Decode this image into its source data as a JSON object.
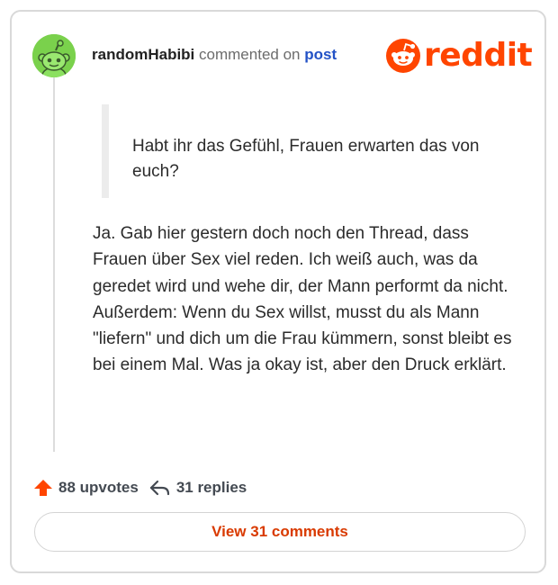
{
  "comment": {
    "username": "randomHabibi",
    "action_text": "commented on",
    "post_link_label": "post",
    "quote": "Habt ihr das Gefühl, Frauen erwarten das von euch?",
    "body": "Ja. Gab hier gestern doch noch den Thread, dass Frauen über Sex viel reden. Ich weiß auch, was da geredet wird und wehe dir, der Mann performt da nicht. Außerdem: Wenn du Sex willst, musst du als Mann \"liefern\" und dich um die Frau kümmern, sonst bleibt es bei einem Mal. Was ja okay ist, aber den Druck erklärt."
  },
  "logo": {
    "text": "reddit",
    "icon": "reddit-alien-icon"
  },
  "stats": {
    "upvotes_label": "88 upvotes",
    "upvote_icon": "upvote-arrow-icon",
    "replies_label": "31 replies",
    "replies_icon": "reply-arrow-icon"
  },
  "actions": {
    "view_comments_label": "View 31 comments"
  },
  "colors": {
    "brand": "#ff4500",
    "link": "#2352c6",
    "avatar_bg": "#7ad14c",
    "cta_text": "#d93a00"
  }
}
